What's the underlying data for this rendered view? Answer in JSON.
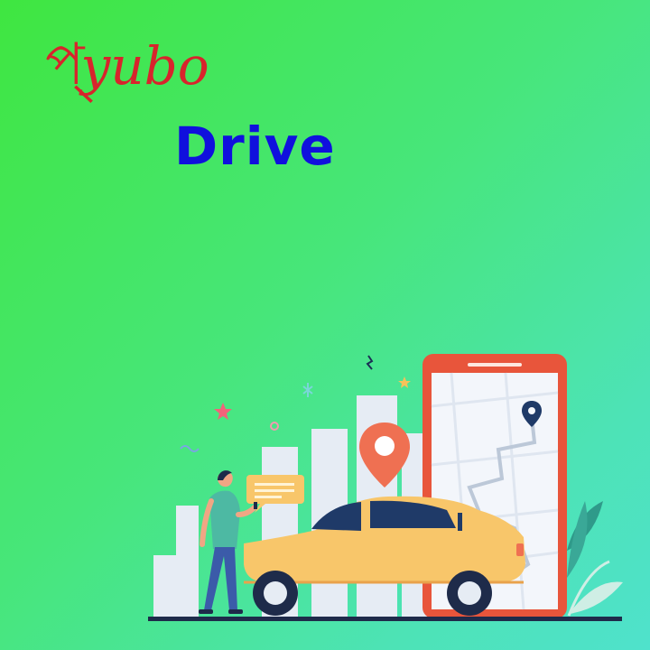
{
  "app": {
    "logo": {
      "script_mark": "প্",
      "script_text": "yubo",
      "brand_word": "Drive"
    }
  },
  "colors": {
    "background_start": "#3fe640",
    "background_end": "#4fe2cc",
    "logo_script": "#d8242c",
    "logo_drive": "#1010dd",
    "phone_frame": "#e8553b",
    "car_body": "#f8c66a",
    "map_pin": "#ef7052"
  },
  "icons": [
    "map-pin-icon",
    "destination-pin-icon",
    "chat-bubble-icon",
    "star-icon",
    "sparkle-icon"
  ]
}
